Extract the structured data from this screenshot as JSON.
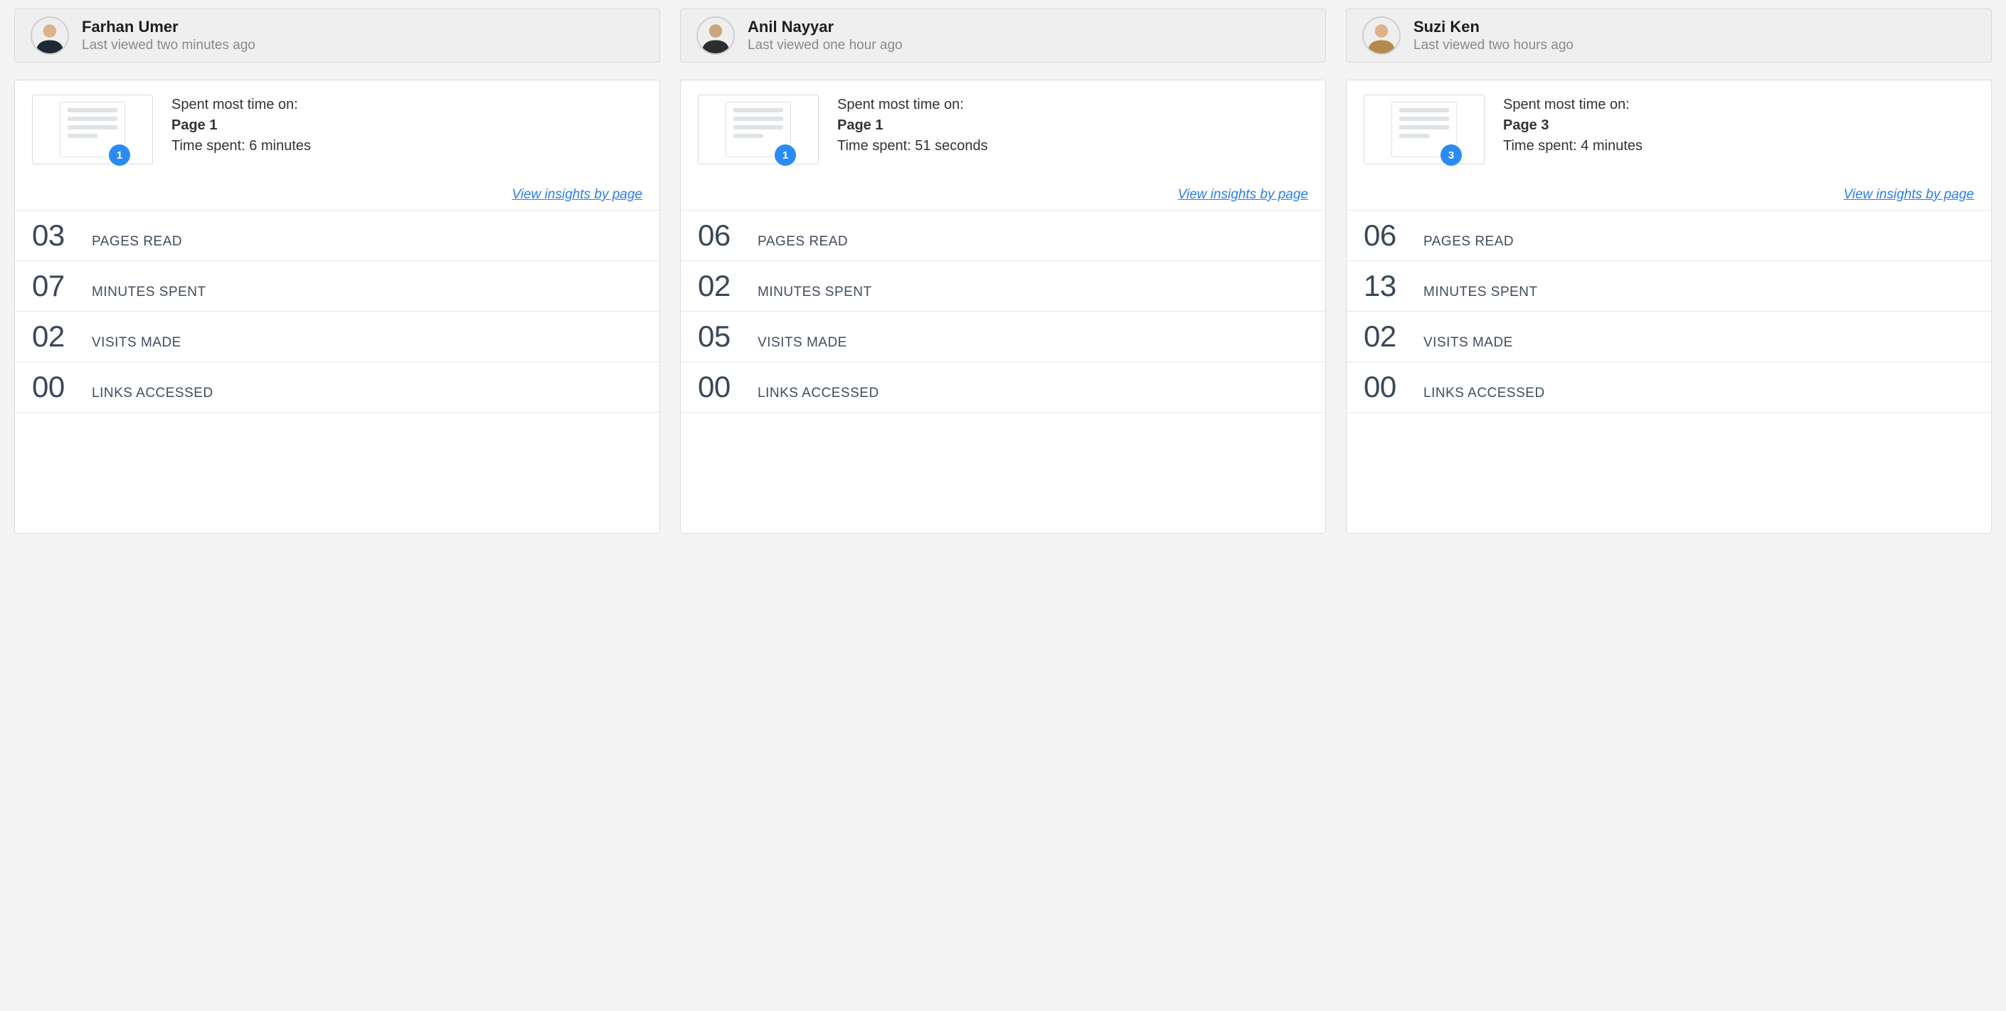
{
  "labels": {
    "spent_most_time_on": "Spent most time on:",
    "time_spent_prefix": "Time spent: ",
    "view_insights": "View insights by page",
    "pages_read": "PAGES READ",
    "minutes_spent": "MINUTES SPENT",
    "visits_made": "VISITS MADE",
    "links_accessed": "LINKS ACCESSED"
  },
  "people": [
    {
      "name": "Farhan Umer",
      "last_viewed": "Last viewed two minutes ago",
      "avatar_skin": "#dbb48c",
      "avatar_shirt": "#1f2a36",
      "top_page_label": "Page 1",
      "top_page_badge": "1",
      "time_spent": "6 minutes",
      "stats": {
        "pages_read": "03",
        "minutes_spent": "07",
        "visits_made": "02",
        "links_accessed": "00"
      }
    },
    {
      "name": "Anil Nayyar",
      "last_viewed": "Last viewed one hour ago",
      "avatar_skin": "#c9a67d",
      "avatar_shirt": "#2d2d2d",
      "top_page_label": "Page 1",
      "top_page_badge": "1",
      "time_spent": "51 seconds",
      "stats": {
        "pages_read": "06",
        "minutes_spent": "02",
        "visits_made": "05",
        "links_accessed": "00"
      }
    },
    {
      "name": "Suzi Ken",
      "last_viewed": "Last viewed two hours ago",
      "avatar_skin": "#e0b08a",
      "avatar_shirt": "#b4894e",
      "top_page_label": "Page 3",
      "top_page_badge": "3",
      "time_spent": "4 minutes",
      "stats": {
        "pages_read": "06",
        "minutes_spent": "13",
        "visits_made": "02",
        "links_accessed": "00"
      }
    }
  ]
}
